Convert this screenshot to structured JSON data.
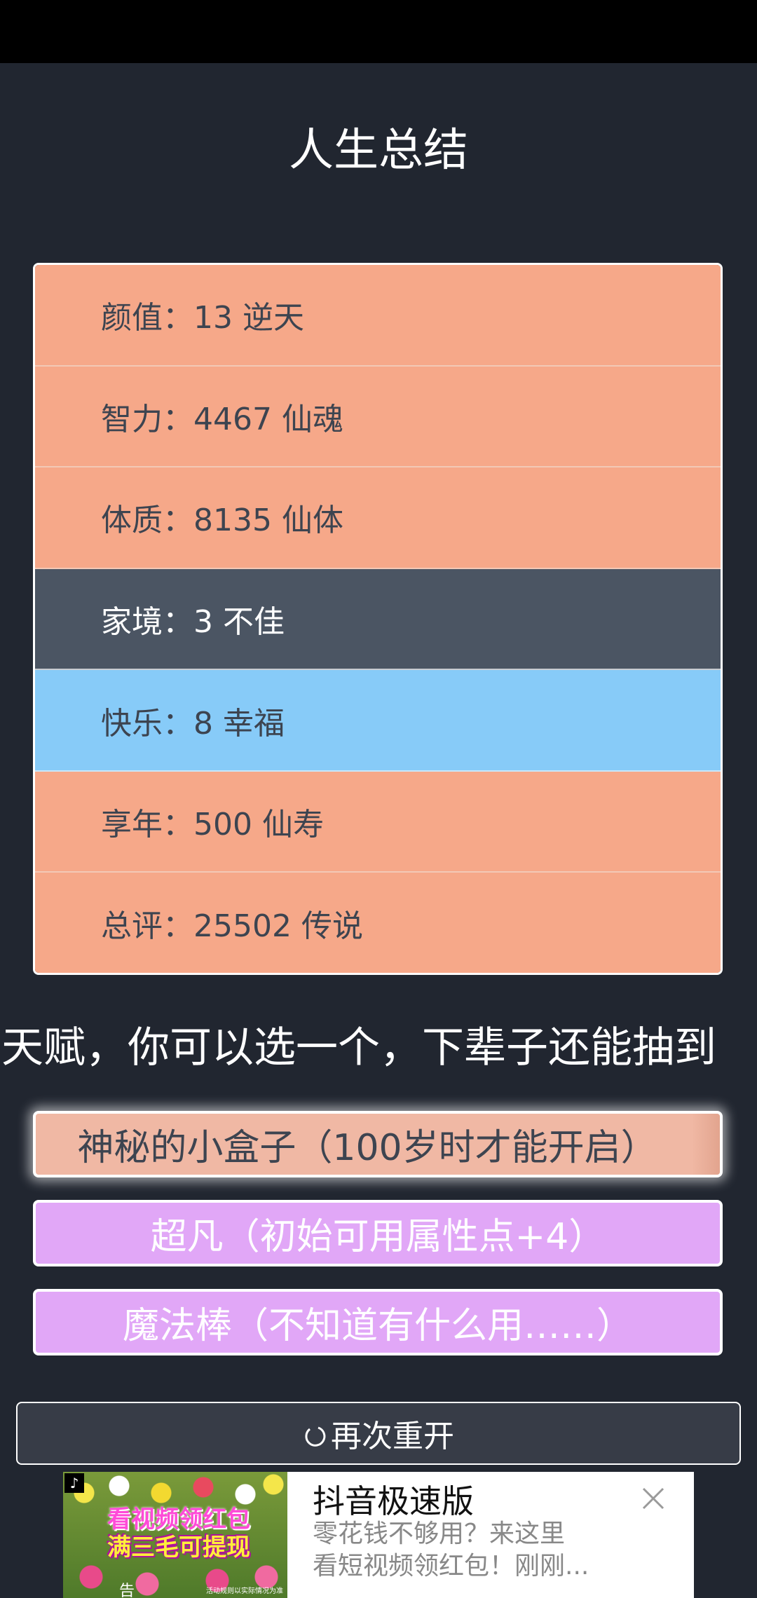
{
  "page": {
    "title": "人生总结"
  },
  "summary": {
    "rows": [
      {
        "label": "颜值：13 逆天"
      },
      {
        "label": "智力：4467 仙魂"
      },
      {
        "label": "体质：8135 仙体"
      },
      {
        "label": "家境：3 不佳"
      },
      {
        "label": "快乐：8 幸福"
      },
      {
        "label": "享年：500 仙寿"
      },
      {
        "label": "总评：25502 传说"
      }
    ]
  },
  "talents": {
    "prompt": "天赋，你可以选一个，下辈子还能抽到",
    "items": [
      {
        "label": "神秘的小盒子（100岁时才能开启）"
      },
      {
        "label": "超凡（初始可用属性点+4）"
      },
      {
        "label": "魔法棒（不知道有什么用……）"
      }
    ]
  },
  "restart": {
    "label": "再次重开",
    "icon": "refresh-icon"
  },
  "ad": {
    "title": "抖音极速版",
    "desc_line1": "零花钱不够用？来这里",
    "desc_line2": "看短视频领红包！刚刚...",
    "image_line1": "看视频领红包",
    "image_line2": "满三毛可提现",
    "image_badge": "告",
    "image_fine_print": "活动规则以实际情况为准",
    "close_icon": "close-icon"
  },
  "colors": {
    "background": "#212630",
    "orange_row": "#f6a889",
    "dark_row": "#4b5563",
    "blue_row": "#87cbf8",
    "selected_talent": "#f0b8a4",
    "purple_talent": "#e1a7f7"
  }
}
